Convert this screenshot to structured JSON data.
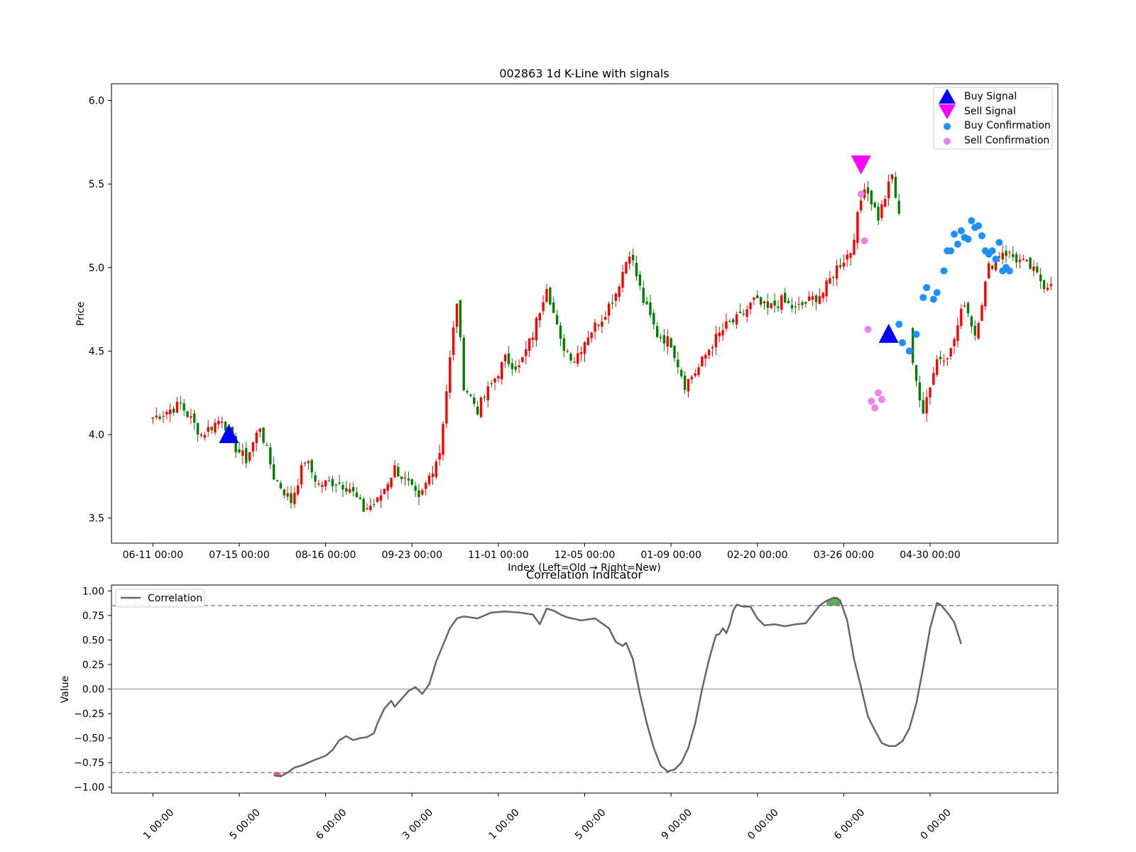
{
  "chart_data": [
    {
      "type": "candlestick",
      "title": "002863 1d K-Line with signals",
      "xlabel": "Index (Left=Old → Right=New)",
      "ylabel": "Price",
      "ylim": [
        3.35,
        6.1
      ],
      "yticks": [
        "3.5",
        "4.0",
        "4.5",
        "5.0",
        "5.5",
        "6.0"
      ],
      "xticks": [
        {
          "index": 0,
          "label": "06-11 00:00"
        },
        {
          "index": 25,
          "label": "07-15 00:00"
        },
        {
          "index": 50,
          "label": "08-16 00:00"
        },
        {
          "index": 75,
          "label": "09-23 00:00"
        },
        {
          "index": 100,
          "label": "11-01 00:00"
        },
        {
          "index": 125,
          "label": "12-05 00:00"
        },
        {
          "index": 150,
          "label": "01-09 00:00"
        },
        {
          "index": 175,
          "label": "02-20 00:00"
        },
        {
          "index": 200,
          "label": "03-26 00:00"
        },
        {
          "index": 225,
          "label": "04-30 00:00"
        }
      ],
      "xlim": [
        -12,
        262
      ],
      "close_anchors": [
        [
          0,
          4.1
        ],
        [
          8,
          4.18
        ],
        [
          14,
          4.0
        ],
        [
          20,
          4.1
        ],
        [
          24,
          3.92
        ],
        [
          27,
          3.85
        ],
        [
          31,
          4.05
        ],
        [
          35,
          3.75
        ],
        [
          40,
          3.6
        ],
        [
          44,
          3.85
        ],
        [
          48,
          3.7
        ],
        [
          53,
          3.72
        ],
        [
          57,
          3.68
        ],
        [
          61,
          3.55
        ],
        [
          65,
          3.6
        ],
        [
          70,
          3.8
        ],
        [
          74,
          3.7
        ],
        [
          77,
          3.6
        ],
        [
          80,
          3.75
        ],
        [
          83,
          3.9
        ],
        [
          86,
          4.45
        ],
        [
          88,
          4.8
        ],
        [
          90,
          4.3
        ],
        [
          94,
          4.15
        ],
        [
          98,
          4.3
        ],
        [
          102,
          4.45
        ],
        [
          106,
          4.4
        ],
        [
          110,
          4.6
        ],
        [
          114,
          4.9
        ],
        [
          118,
          4.55
        ],
        [
          122,
          4.45
        ],
        [
          126,
          4.6
        ],
        [
          130,
          4.7
        ],
        [
          134,
          4.85
        ],
        [
          138,
          5.1
        ],
        [
          142,
          4.8
        ],
        [
          146,
          4.6
        ],
        [
          150,
          4.55
        ],
        [
          154,
          4.3
        ],
        [
          158,
          4.4
        ],
        [
          162,
          4.55
        ],
        [
          166,
          4.65
        ],
        [
          170,
          4.7
        ],
        [
          174,
          4.8
        ],
        [
          178,
          4.75
        ],
        [
          182,
          4.8
        ],
        [
          186,
          4.75
        ],
        [
          190,
          4.8
        ],
        [
          194,
          4.85
        ],
        [
          198,
          5.0
        ],
        [
          202,
          5.1
        ],
        [
          206,
          5.5
        ],
        [
          210,
          5.3
        ],
        [
          214,
          5.55
        ],
        [
          216,
          5.3
        ],
        [
          220,
          4.4
        ],
        [
          223,
          4.15
        ],
        [
          227,
          4.45
        ],
        [
          231,
          4.5
        ],
        [
          235,
          4.8
        ],
        [
          238,
          4.6
        ],
        [
          242,
          5.0
        ],
        [
          246,
          5.1
        ],
        [
          250,
          5.05
        ],
        [
          254,
          5.0
        ],
        [
          258,
          4.9
        ],
        [
          260,
          4.9
        ]
      ],
      "buy_signals": [
        {
          "x": 22,
          "y": 4.0
        },
        {
          "x": 213,
          "y": 4.6
        }
      ],
      "sell_signals": [
        {
          "x": 205,
          "y": 5.62
        }
      ],
      "buy_confirmations": [
        [
          216,
          4.66
        ],
        [
          217,
          4.55
        ],
        [
          219,
          4.5
        ],
        [
          221,
          4.6
        ],
        [
          223,
          4.82
        ],
        [
          224,
          4.88
        ],
        [
          226,
          4.81
        ],
        [
          227,
          4.85
        ],
        [
          229,
          4.98
        ],
        [
          230,
          5.1
        ],
        [
          231,
          5.1
        ],
        [
          232,
          5.2
        ],
        [
          233,
          5.14
        ],
        [
          234,
          5.22
        ],
        [
          235,
          5.18
        ],
        [
          236,
          5.17
        ],
        [
          237,
          5.28
        ],
        [
          238,
          5.24
        ],
        [
          239,
          5.25
        ],
        [
          240,
          5.19
        ],
        [
          241,
          5.1
        ],
        [
          242,
          5.08
        ],
        [
          243,
          5.1
        ],
        [
          244,
          5.05
        ],
        [
          245,
          5.15
        ],
        [
          246,
          4.98
        ],
        [
          247,
          5.0
        ],
        [
          248,
          4.98
        ]
      ],
      "sell_confirmations": [
        [
          205,
          5.44
        ],
        [
          206,
          5.16
        ],
        [
          207,
          4.63
        ],
        [
          208,
          4.2
        ],
        [
          209,
          4.16
        ],
        [
          210,
          4.25
        ],
        [
          211,
          4.21
        ]
      ],
      "legend": {
        "placement": "upper-right",
        "items": [
          {
            "label": "Buy Signal",
            "marker": "triangle-up",
            "color": "#0000ff"
          },
          {
            "label": "Sell Signal",
            "marker": "triangle-down",
            "color": "#ff00ff"
          },
          {
            "label": "Buy Confirmation",
            "marker": "circle",
            "color": "#1e90ff"
          },
          {
            "label": "Sell Confirmation",
            "marker": "circle",
            "color": "#ee82ee"
          }
        ]
      },
      "colors": {
        "up": "#ff0000",
        "down": "#008000"
      }
    },
    {
      "type": "line",
      "title": "Correlation Indicator",
      "ylabel": "Value",
      "ylim": [
        -1.06,
        1.06
      ],
      "yticks": [
        "−1.00",
        "−0.75",
        "−0.50",
        "−0.25",
        "0.00",
        "0.25",
        "0.50",
        "0.75",
        "1.00"
      ],
      "xticks": [
        "1 00:00",
        "5 00:00",
        "6 00:00",
        "3 00:00",
        "1 00:00",
        "5 00:00",
        "9 00:00",
        "0 00:00",
        "6 00:00",
        "0 00:00"
      ],
      "thresholds": [
        0.85,
        -0.85,
        0.0
      ],
      "series": [
        {
          "name": "Correlation",
          "color": "#666666",
          "points": [
            [
              35,
              -0.88
            ],
            [
              37,
              -0.89
            ],
            [
              39,
              -0.85
            ],
            [
              41,
              -0.8
            ],
            [
              43,
              -0.78
            ],
            [
              45,
              -0.75
            ],
            [
              47,
              -0.72
            ],
            [
              50,
              -0.68
            ],
            [
              52,
              -0.62
            ],
            [
              54,
              -0.52
            ],
            [
              56,
              -0.48
            ],
            [
              58,
              -0.52
            ],
            [
              60,
              -0.5
            ],
            [
              62,
              -0.49
            ],
            [
              64,
              -0.45
            ],
            [
              65,
              -0.35
            ],
            [
              67,
              -0.2
            ],
            [
              69,
              -0.12
            ],
            [
              70,
              -0.18
            ],
            [
              72,
              -0.1
            ],
            [
              74,
              -0.02
            ],
            [
              76,
              0.02
            ],
            [
              78,
              -0.05
            ],
            [
              80,
              0.05
            ],
            [
              82,
              0.28
            ],
            [
              84,
              0.45
            ],
            [
              86,
              0.62
            ],
            [
              88,
              0.72
            ],
            [
              90,
              0.74
            ],
            [
              94,
              0.72
            ],
            [
              98,
              0.78
            ],
            [
              102,
              0.79
            ],
            [
              106,
              0.78
            ],
            [
              110,
              0.76
            ],
            [
              112,
              0.66
            ],
            [
              114,
              0.82
            ],
            [
              116,
              0.8
            ],
            [
              118,
              0.76
            ],
            [
              120,
              0.73
            ],
            [
              124,
              0.7
            ],
            [
              128,
              0.72
            ],
            [
              132,
              0.62
            ],
            [
              134,
              0.48
            ],
            [
              136,
              0.44
            ],
            [
              137,
              0.47
            ],
            [
              139,
              0.3
            ],
            [
              141,
              -0.05
            ],
            [
              143,
              -0.35
            ],
            [
              145,
              -0.6
            ],
            [
              147,
              -0.78
            ],
            [
              149,
              -0.84
            ],
            [
              151,
              -0.82
            ],
            [
              153,
              -0.75
            ],
            [
              155,
              -0.6
            ],
            [
              157,
              -0.35
            ],
            [
              159,
              0.0
            ],
            [
              161,
              0.3
            ],
            [
              163,
              0.55
            ],
            [
              164,
              0.56
            ],
            [
              165,
              0.62
            ],
            [
              166,
              0.57
            ],
            [
              167,
              0.66
            ],
            [
              168,
              0.8
            ],
            [
              169,
              0.86
            ],
            [
              171,
              0.84
            ],
            [
              173,
              0.84
            ],
            [
              175,
              0.72
            ],
            [
              177,
              0.65
            ],
            [
              180,
              0.66
            ],
            [
              183,
              0.64
            ],
            [
              186,
              0.66
            ],
            [
              189,
              0.67
            ],
            [
              191,
              0.76
            ],
            [
              193,
              0.85
            ],
            [
              195,
              0.9
            ],
            [
              197,
              0.93
            ],
            [
              198,
              0.93
            ],
            [
              199,
              0.9
            ],
            [
              201,
              0.7
            ],
            [
              203,
              0.3
            ],
            [
              205,
              0.02
            ],
            [
              207,
              -0.28
            ],
            [
              209,
              -0.42
            ],
            [
              211,
              -0.55
            ],
            [
              213,
              -0.58
            ],
            [
              215,
              -0.58
            ],
            [
              217,
              -0.53
            ],
            [
              219,
              -0.4
            ],
            [
              221,
              -0.15
            ],
            [
              223,
              0.22
            ],
            [
              225,
              0.62
            ],
            [
              227,
              0.88
            ],
            [
              228,
              0.86
            ],
            [
              230,
              0.78
            ],
            [
              232,
              0.68
            ],
            [
              234,
              0.46
            ]
          ]
        }
      ],
      "legend": {
        "placement": "upper-left",
        "items": [
          {
            "label": "Correlation"
          }
        ]
      },
      "fill_colors": {
        "above": "#2e8b2e",
        "below": "#e0284e"
      }
    }
  ]
}
